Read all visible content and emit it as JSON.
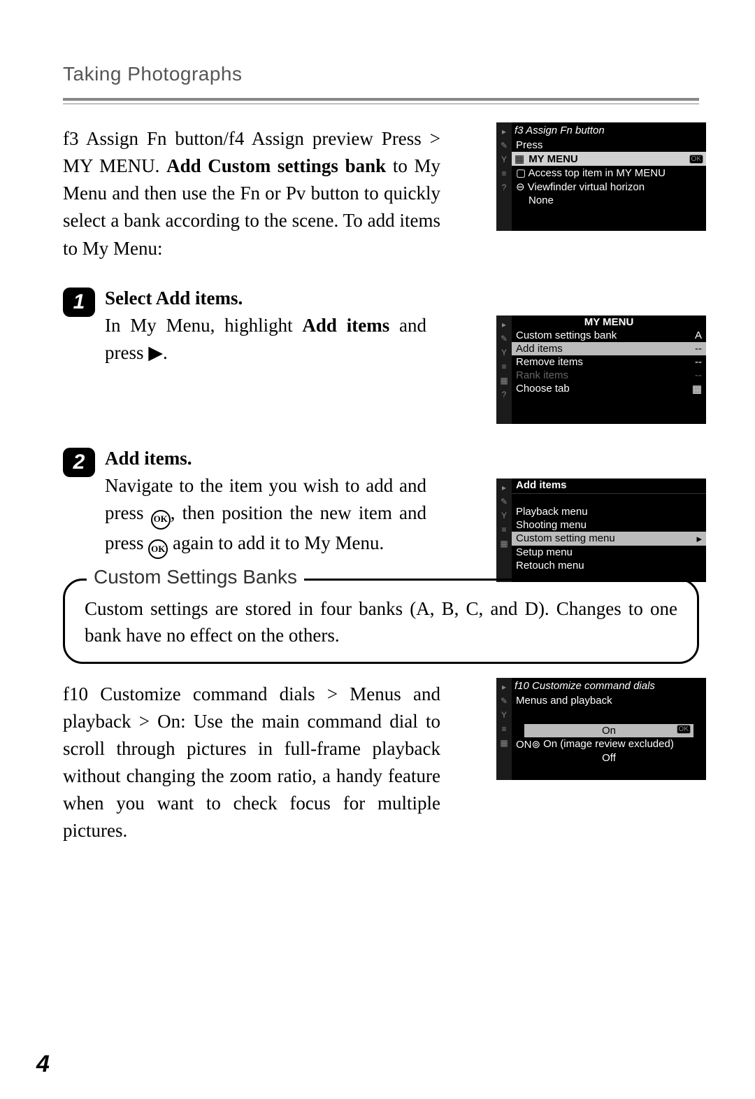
{
  "header": "Taking Photographs",
  "intro": {
    "part1": "f3 Assign Fn button/f4 Assign preview Press > MY MENU. ",
    "bold1": "Add Custom settings bank",
    "part2": " to My Menu and then use the Fn or Pv button to quickly select a bank according to the scene. To add items to My Menu:"
  },
  "steps": [
    {
      "num": "1",
      "title_a": "Select ",
      "title_b": "Add items.",
      "body_a": "In My Menu, highlight ",
      "body_bold": "Add items",
      "body_b": " and press ▶."
    },
    {
      "num": "2",
      "title_a": "",
      "title_b": "Add items.",
      "body_a": "Navigate to the item you wish to add and press ",
      "body_bold": "",
      "body_b": ", then position the new item and press ",
      "body_c": " again to add it to My Menu."
    }
  ],
  "callout": {
    "title": "Custom Settings Banks",
    "body": "Custom settings are stored in four banks (A, B, C, and D). Changes to one bank have no effect on the others."
  },
  "para2": {
    "line": "f10 Customize command dials > Menus and playback > On: Use the main command dial to scroll through pictures in full-frame playback without changing the zoom ratio, a handy feature when you want to check focus for multiple pictures."
  },
  "shots": {
    "a": {
      "title": "f3 Assign Fn button",
      "sub": "Press",
      "bar": "MY MENU",
      "items": [
        "Access top item in MY MENU",
        "Viewfinder virtual horizon",
        "None"
      ]
    },
    "b": {
      "title": "MY MENU",
      "rows": [
        {
          "l": "Custom settings bank",
          "r": "A"
        },
        {
          "l": "Add items",
          "r": "--"
        },
        {
          "l": "Remove items",
          "r": "--"
        },
        {
          "l": "Rank items",
          "r": "--",
          "dim": true
        },
        {
          "l": "Choose tab",
          "r": "▦"
        }
      ]
    },
    "c": {
      "title": "Add items",
      "items": [
        "Playback menu",
        "Shooting menu",
        "Custom setting menu",
        "Setup menu",
        "Retouch menu"
      ],
      "hl_index": 2
    },
    "d": {
      "title": "f10 Customize command dials",
      "sub": "Menus and playback",
      "items": [
        "On",
        "On (image review excluded)",
        "Off"
      ],
      "hl_index": 0,
      "prefix1": "ON⊚"
    }
  },
  "page_number": "4"
}
